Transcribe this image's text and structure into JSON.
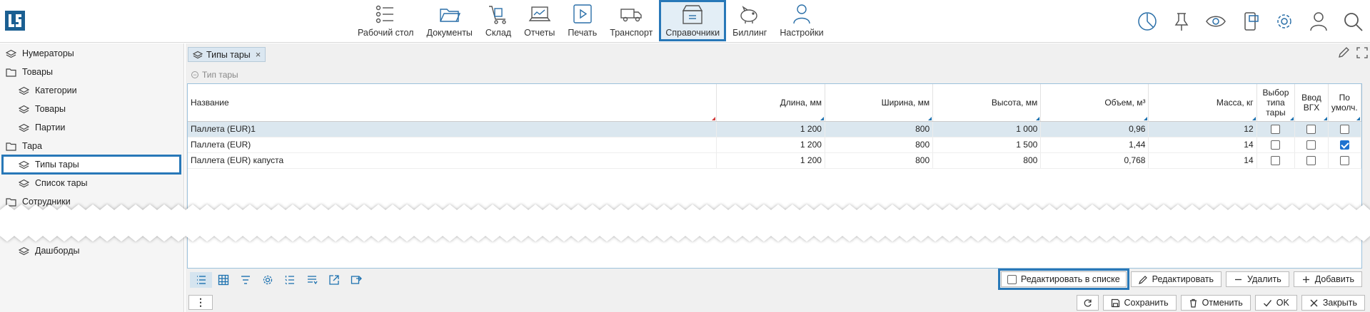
{
  "nav": {
    "items": [
      {
        "label": "Рабочий стол",
        "icon": "desktop-list-icon"
      },
      {
        "label": "Документы",
        "icon": "folder-icon"
      },
      {
        "label": "Склад",
        "icon": "warehouse-cart-icon"
      },
      {
        "label": "Отчеты",
        "icon": "reports-laptop-icon"
      },
      {
        "label": "Печать",
        "icon": "print-play-icon"
      },
      {
        "label": "Транспорт",
        "icon": "truck-icon"
      },
      {
        "label": "Справочники",
        "icon": "reference-box-icon",
        "active": true
      },
      {
        "label": "Биллинг",
        "icon": "billing-piggy-icon"
      },
      {
        "label": "Настройки",
        "icon": "settings-person-icon"
      }
    ]
  },
  "right_icons": [
    "timer-icon",
    "pin-icon",
    "eye-icon",
    "phone-chat-icon",
    "gear-icon",
    "user-icon",
    "search-icon"
  ],
  "sidebar": {
    "items": [
      {
        "label": "Нумераторы",
        "icon": "layers-icon"
      },
      {
        "label": "Товары",
        "icon": "folder-icon"
      },
      {
        "label": "Категории",
        "icon": "layers-icon"
      },
      {
        "label": "Товары",
        "icon": "layers-icon"
      },
      {
        "label": "Партии",
        "icon": "layers-icon"
      },
      {
        "label": "Тара",
        "icon": "folder-icon"
      },
      {
        "label": "Типы тары",
        "icon": "layers-icon",
        "selected": true
      },
      {
        "label": "Список тары",
        "icon": "layers-icon"
      },
      {
        "label": "Сотрудники",
        "icon": "folder-icon"
      },
      {
        "label": "Дашборды",
        "icon": "layers-icon"
      }
    ]
  },
  "tab": {
    "label": "Типы тары",
    "close": "×"
  },
  "group_legend": "Тип тары",
  "table": {
    "columns": [
      {
        "label": "Название"
      },
      {
        "label": "Длина, мм"
      },
      {
        "label": "Ширина, мм"
      },
      {
        "label": "Высота, мм"
      },
      {
        "label": "Объем, м³"
      },
      {
        "label": "Масса, кг"
      },
      {
        "label": "Выбор типа тары"
      },
      {
        "label": "Ввод ВГХ"
      },
      {
        "label": "По умолч."
      }
    ],
    "rows": [
      {
        "name": "Паллета (EUR)1",
        "length": "1 200",
        "width": "800",
        "height": "1 000",
        "volume": "0,96",
        "mass": "12",
        "choose": false,
        "vgh": false,
        "default": false
      },
      {
        "name": "Паллета (EUR)",
        "length": "1 200",
        "width": "800",
        "height": "1 500",
        "volume": "1,44",
        "mass": "14",
        "choose": false,
        "vgh": false,
        "default": true
      },
      {
        "name": "Паллета (EUR) капуста",
        "length": "1 200",
        "width": "800",
        "height": "800",
        "volume": "0,768",
        "mass": "14",
        "choose": false,
        "vgh": false,
        "default": false
      }
    ]
  },
  "toolbar": {
    "edit_in_list": "Редактировать в списке",
    "edit": "Редактировать",
    "delete": "Удалить",
    "add": "Добавить"
  },
  "footer": {
    "more": "⋮",
    "save": "Сохранить",
    "cancel": "Отменить",
    "ok": "OK",
    "close": "Закрыть"
  }
}
